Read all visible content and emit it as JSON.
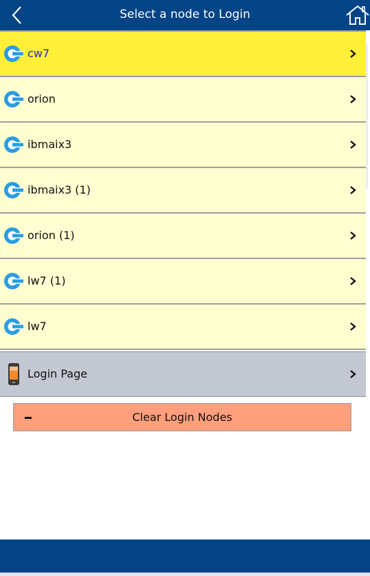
{
  "header": {
    "title": "Select a node to Login",
    "back_icon": "chevron-left-icon",
    "home_icon": "home-icon"
  },
  "nodes": [
    {
      "label": "cw7",
      "selected": true
    },
    {
      "label": "orion",
      "selected": false
    },
    {
      "label": "ibmaix3",
      "selected": false
    },
    {
      "label": "ibmaix3 (1)",
      "selected": false
    },
    {
      "label": "orion (1)",
      "selected": false
    },
    {
      "label": "lw7 (1)",
      "selected": false
    },
    {
      "label": "lw7",
      "selected": false
    }
  ],
  "login_page": {
    "label": "Login Page",
    "icon": "phone-icon"
  },
  "clear_button": {
    "label": "Clear Login Nodes",
    "icon": "minus-icon"
  },
  "colors": {
    "header_bg": "#034487",
    "row_bg": "#fffed0",
    "selected_row_bg": "#ffef38",
    "login_row_bg": "#c3c8d2",
    "clear_button_bg": "#ff9f7d",
    "node_icon": "#2a9de2"
  }
}
